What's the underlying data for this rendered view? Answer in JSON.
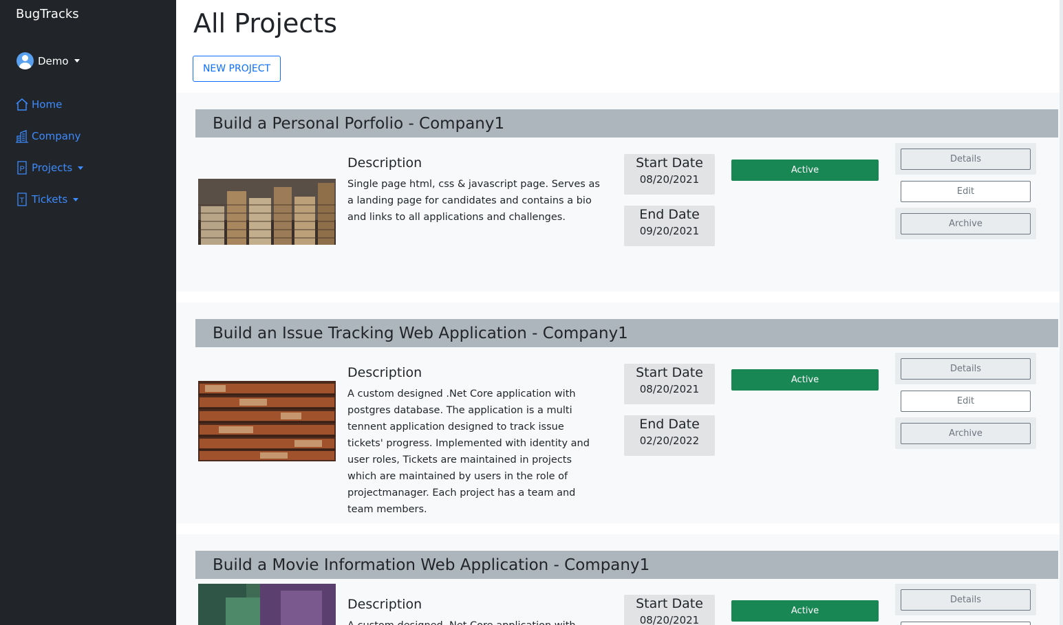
{
  "app": {
    "brand": "BugTracks"
  },
  "user": {
    "name": "Demo"
  },
  "nav": {
    "home": "Home",
    "company": "Company",
    "projects": "Projects",
    "tickets": "Tickets"
  },
  "page": {
    "title": "All Projects",
    "new_project": "NEW PROJECT"
  },
  "labels": {
    "description": "Description",
    "start_date": "Start Date",
    "end_date": "End Date",
    "details": "Details",
    "edit": "Edit",
    "archive": "Archive"
  },
  "projects": [
    {
      "title": "Build a Personal Porfolio - Company1",
      "description": "Single page html, css & javascript page. Serves as a landing page for candidates and contains a bio and links to all applications and challenges.",
      "start": "08/20/2021",
      "end": "09/20/2021",
      "status": "Active"
    },
    {
      "title": "Build an Issue Tracking Web Application - Company1",
      "description": "A custom designed .Net Core application with postgres database. The application is a multi tennent application designed to track issue tickets' progress. Implemented with identity and user roles, Tickets are maintained in projects which are maintained by users in the role of projectmanager. Each project has a team and team members.",
      "start": "08/20/2021",
      "end": "02/20/2022",
      "status": "Active"
    },
    {
      "title": "Build a Movie Information Web Application - Company1",
      "description": "A custom designed .Net Core application with",
      "start": "08/20/2021",
      "status": "Active"
    }
  ],
  "colors": {
    "sidebar": "#212529",
    "link": "#3d8bfd",
    "primary": "#0d6efd",
    "active": "#198754",
    "title_bar": "#adb5bd"
  }
}
